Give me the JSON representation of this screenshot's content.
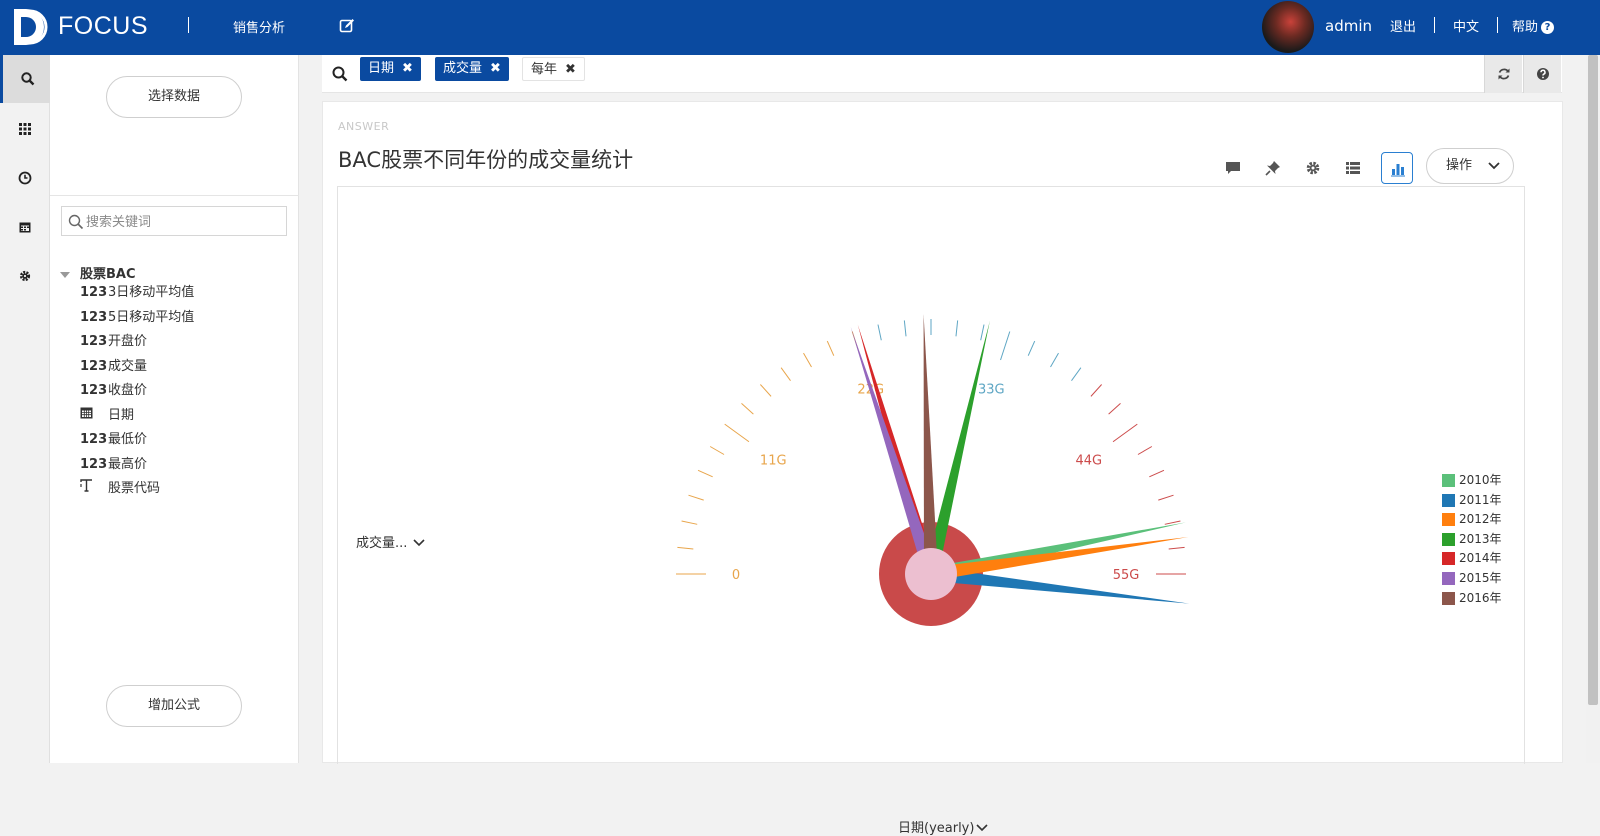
{
  "app": {
    "brand": "FOCUS",
    "nav_item": "销售分析",
    "user": "admin",
    "logout": "退出",
    "language": "中文",
    "help": "帮助"
  },
  "panel": {
    "select_data": "选择数据",
    "search_placeholder": "搜索关键词",
    "table_name": "股票BAC",
    "fields": [
      {
        "type": "123",
        "name": "3日移动平均值"
      },
      {
        "type": "123",
        "name": "5日移动平均值"
      },
      {
        "type": "123",
        "name": "开盘价"
      },
      {
        "type": "123",
        "name": "成交量"
      },
      {
        "type": "123",
        "name": "收盘价"
      },
      {
        "type": "calendar-icon",
        "name": "日期"
      },
      {
        "type": "123",
        "name": "最低价"
      },
      {
        "type": "123",
        "name": "最高价"
      },
      {
        "type": "text-icon",
        "name": "股票代码"
      }
    ],
    "add_formula": "增加公式"
  },
  "query": {
    "chips": [
      "日期",
      "成交量",
      "每年"
    ]
  },
  "answer": {
    "label": "ANSWER",
    "title": "BAC股票不同年份的成交量统计",
    "ops": "操作",
    "y_selector": "成交量...",
    "x_selector": "日期(yearly)"
  },
  "chart_data": {
    "type": "gauge",
    "title": "BAC股票不同年份的成交量统计",
    "min": 0,
    "max": 55,
    "axis_labels": [
      "0",
      "11G",
      "22G",
      "33G",
      "44G",
      "55G"
    ],
    "axis_colors": [
      {
        "to": 22,
        "color": "#e8a54b"
      },
      {
        "to": 39,
        "color": "#5ea6c4"
      },
      {
        "to": 55,
        "color": "#cc4b4b"
      }
    ],
    "series": [
      {
        "name": "2010年",
        "value": 51.5,
        "color": "#5bc07a"
      },
      {
        "name": "2011年",
        "value": 57.0,
        "color": "#1f77b4"
      },
      {
        "name": "2012年",
        "value": 52.5,
        "color": "#ff7f0e"
      },
      {
        "name": "2013年",
        "value": 31.5,
        "color": "#2ca02c"
      },
      {
        "name": "2014年",
        "value": 22.5,
        "color": "#d62728"
      },
      {
        "name": "2015年",
        "value": 22.0,
        "color": "#9467bd"
      },
      {
        "name": "2016年",
        "value": 27.0,
        "color": "#8c564b"
      }
    ]
  }
}
